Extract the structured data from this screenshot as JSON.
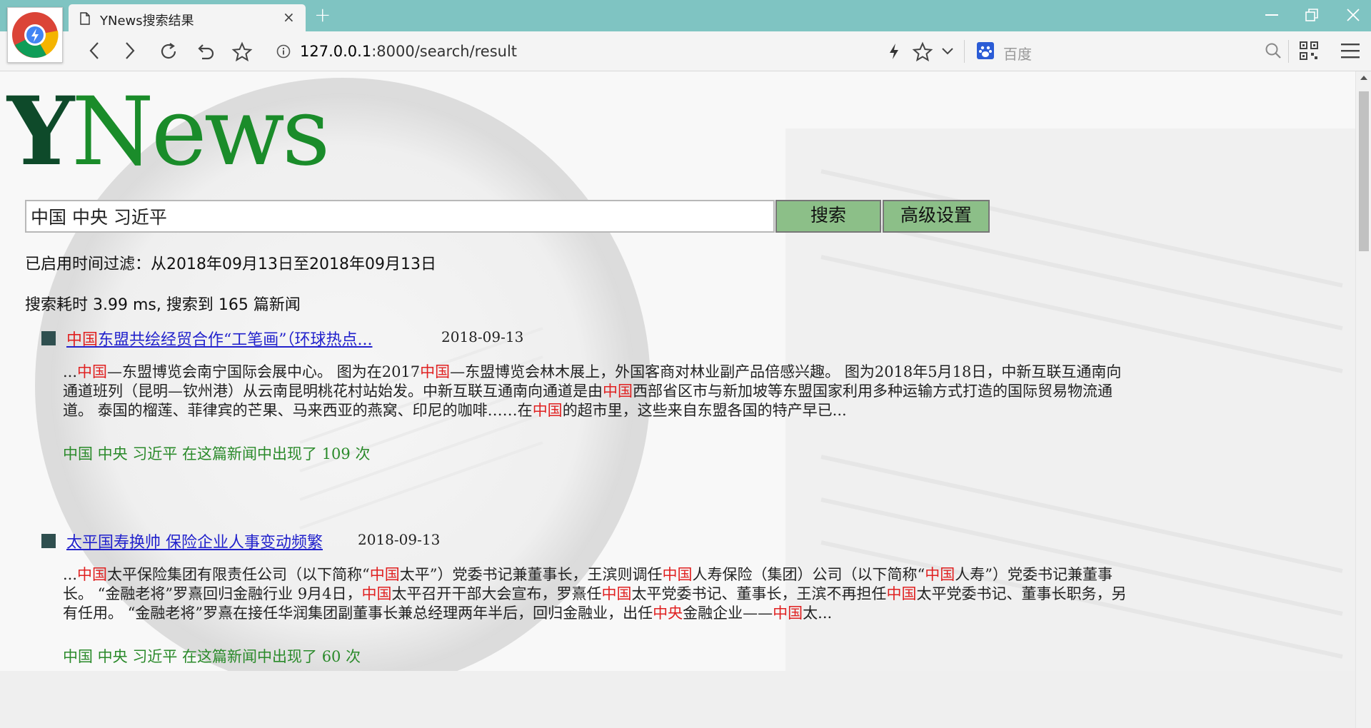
{
  "browser": {
    "tab_title": "YNews搜索结果",
    "tab_close": "×",
    "new_tab": "+",
    "url_host": "127.0.0.1",
    "url_rest": ":8000/search/result",
    "search_engine": "百度"
  },
  "colors": {
    "accent": "#1a8c2a",
    "highlight": "#e02020",
    "link": "#2222cc",
    "button": "#8cbf88",
    "tabbar": "#7fc4c2"
  },
  "logo": {
    "y": "Y",
    "rest": "News"
  },
  "search": {
    "value": "中国 中央 习近平",
    "search_label": "搜索",
    "advanced_label": "高级设置"
  },
  "filter_text": "已启用时间过滤：从2018年09月13日至2018年09月13日",
  "stats_text": "搜索耗时 3.99 ms, 搜索到 165 篇新闻",
  "results": [
    {
      "title_hl": "中国",
      "title_rest": "东盟共绘经贸合作“工笔画”（环球热点...",
      "date": "2018-09-13",
      "snippet": [
        {
          "t": "...",
          "h": false
        },
        {
          "t": "中国",
          "h": true
        },
        {
          "t": "—东盟博览会南宁国际会展中心。 图为在2017",
          "h": false
        },
        {
          "t": "中国",
          "h": true
        },
        {
          "t": "—东盟博览会林木展上，外国客商对林业副产品倍感兴趣。 图为2018年5月18日，中新互联互通南向通道班列（昆明—钦州港）从云南昆明桃花村站始发。中新互联互通南向通道是由",
          "h": false
        },
        {
          "t": "中国",
          "h": true
        },
        {
          "t": "西部省区市与新加坡等东盟国家利用多种运输方式打造的国际贸易物流通道。 泰国的榴莲、菲律宾的芒果、马来西亚的燕窝、印尼的咖啡……在",
          "h": false
        },
        {
          "t": "中国",
          "h": true
        },
        {
          "t": "的超市里，这些来自东盟各国的特产早已...",
          "h": false
        }
      ],
      "count_text": "中国 中央 习近平 在这篇新闻中出现了 109 次"
    },
    {
      "title_hl": "",
      "title_rest": "太平国寿换帅 保险企业人事变动频繁",
      "date": "2018-09-13",
      "snippet": [
        {
          "t": "...",
          "h": false
        },
        {
          "t": "中国",
          "h": true
        },
        {
          "t": "太平保险集团有限责任公司（以下简称“",
          "h": false
        },
        {
          "t": "中国",
          "h": true
        },
        {
          "t": "太平”）党委书记兼董事长，王滨则调任",
          "h": false
        },
        {
          "t": "中国",
          "h": true
        },
        {
          "t": "人寿保险（集团）公司（以下简称“",
          "h": false
        },
        {
          "t": "中国",
          "h": true
        },
        {
          "t": "人寿”）党委书记兼董事长。 “金融老将”罗熹回归金融行业 9月4日，",
          "h": false
        },
        {
          "t": "中国",
          "h": true
        },
        {
          "t": "太平召开干部大会宣布，罗熹任",
          "h": false
        },
        {
          "t": "中国",
          "h": true
        },
        {
          "t": "太平党委书记、董事长，王滨不再担任",
          "h": false
        },
        {
          "t": "中国",
          "h": true
        },
        {
          "t": "太平党委书记、董事长职务，另有任用。 “金融老将”罗熹在接任华润集团副董事长兼总经理两年半后，回归金融业，出任",
          "h": false
        },
        {
          "t": "中央",
          "h": true
        },
        {
          "t": "金融企业——",
          "h": false
        },
        {
          "t": "中国",
          "h": true
        },
        {
          "t": "太...",
          "h": false
        }
      ],
      "count_text": "中国 中央 习近平 在这篇新闻中出现了 60 次"
    }
  ]
}
